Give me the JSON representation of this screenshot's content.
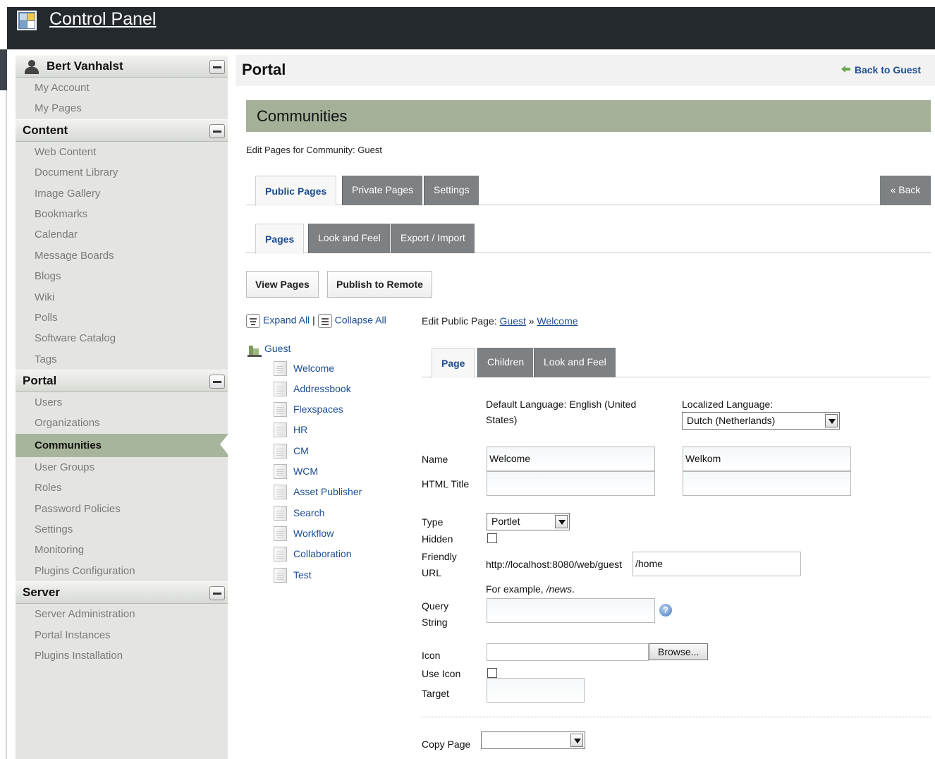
{
  "header": {
    "title": "Control Panel"
  },
  "sidebar": {
    "user": {
      "name": "Bert Vanhalst",
      "items": [
        "My Account",
        "My Pages"
      ]
    },
    "content": {
      "title": "Content",
      "items": [
        "Web Content",
        "Document Library",
        "Image Gallery",
        "Bookmarks",
        "Calendar",
        "Message Boards",
        "Blogs",
        "Wiki",
        "Polls",
        "Software Catalog",
        "Tags"
      ]
    },
    "portal": {
      "title": "Portal",
      "items": [
        "Users",
        "Organizations",
        "Communities",
        "User Groups",
        "Roles",
        "Password Policies",
        "Settings",
        "Monitoring",
        "Plugins Configuration"
      ]
    },
    "server": {
      "title": "Server",
      "items": [
        "Server Administration",
        "Portal Instances",
        "Plugins Installation"
      ]
    }
  },
  "main": {
    "portal_title": "Portal",
    "back_to_guest": "Back to Guest",
    "section_title": "Communities",
    "subtitle": "Edit Pages for Community: Guest",
    "tabs1": [
      "Public Pages",
      "Private Pages",
      "Settings"
    ],
    "back": "« Back",
    "tabs2": [
      "Pages",
      "Look and Feel",
      "Export / Import"
    ],
    "buttons": {
      "view_pages": "View Pages",
      "publish": "Publish to Remote"
    },
    "expand_all": "Expand All",
    "separator": "|",
    "collapse_all": "Collapse All",
    "tree": {
      "root": "Guest",
      "pages": [
        "Welcome",
        "Addressbook",
        "Flexspaces",
        "HR",
        "CM",
        "WCM",
        "Asset Publisher",
        "Search",
        "Workflow",
        "Collaboration",
        "Test"
      ]
    },
    "edit_title": {
      "prefix": "Edit Public Page: ",
      "link1": "Guest",
      "sep": " » ",
      "link2": "Welcome"
    },
    "tabs3": [
      "Page",
      "Children",
      "Look and Feel"
    ],
    "form": {
      "default_language": "Default Language: English (United States)",
      "localized_language_label": "Localized Language:",
      "localized_language": "Dutch (Netherlands)",
      "name_label": "Name",
      "name_value": "Welcome",
      "name_localized": "Welkom",
      "html_title_label": "HTML Title",
      "type_label": "Type",
      "type_value": "Portlet",
      "hidden_label": "Hidden",
      "friendly_url_label": "Friendly URL",
      "friendly_url_prefix": "http://localhost:8080/web/guest",
      "friendly_url_value": "/home",
      "example_prefix": "For example, ",
      "example_value": "/news",
      "example_suffix": ".",
      "query_string_label": "Query String",
      "help_glyph": "?",
      "icon_label": "Icon",
      "browse": "Browse...",
      "use_icon_label": "Use Icon",
      "target_label": "Target",
      "copy_page_label": "Copy Page"
    }
  }
}
